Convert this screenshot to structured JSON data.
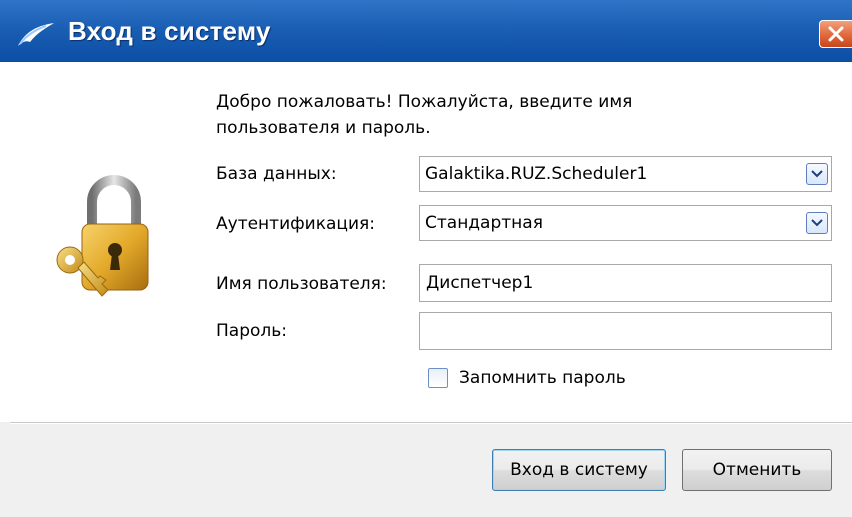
{
  "window": {
    "title": "Вход в систему"
  },
  "welcome": {
    "line1": "Добро пожаловать! Пожалуйста, введите имя",
    "line2": "пользователя и пароль."
  },
  "form": {
    "database_label": "База данных:",
    "database_value": "Galaktika.RUZ.Scheduler1",
    "auth_label": "Аутентификация:",
    "auth_value": "Стандартная",
    "username_label": "Имя пользователя:",
    "username_value": "Диспетчер1",
    "password_label": "Пароль:",
    "password_value": "",
    "remember_label": "Запомнить пароль",
    "remember_checked": false
  },
  "buttons": {
    "login": "Вход в систему",
    "cancel": "Отменить"
  },
  "icons": {
    "app": "app-swoosh-icon",
    "close": "close-icon",
    "lock": "padlock-key-icon",
    "dropdown": "chevron-down-icon"
  },
  "colors": {
    "titlebar": "#1a5fb4",
    "close_button": "#e0683a",
    "dialog_body": "#ffffff",
    "footer": "#f0f0f0"
  }
}
